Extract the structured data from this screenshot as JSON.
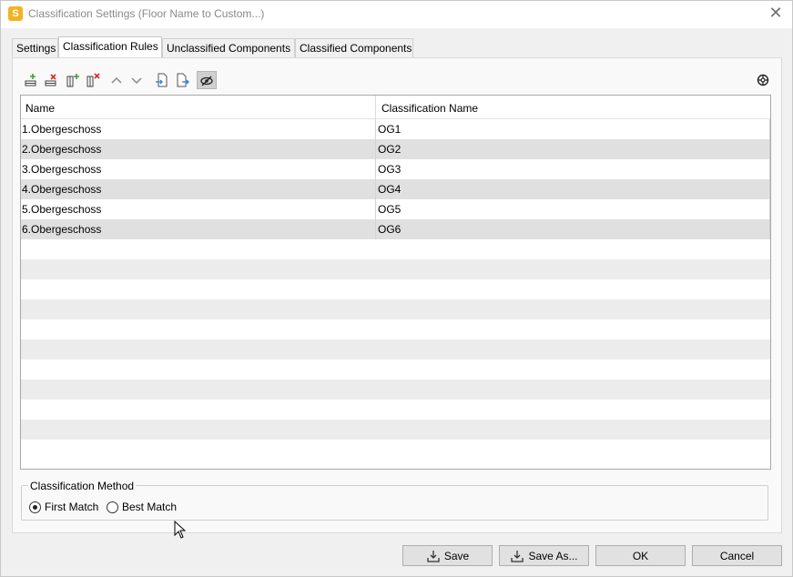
{
  "window": {
    "title": "Classification Settings (Floor Name to Custom...)",
    "app_icon_letter": "S",
    "close_glyph": "✕"
  },
  "tabs": [
    {
      "label": "Settings",
      "active": false
    },
    {
      "label": "Classification Rules",
      "active": true
    },
    {
      "label": "Unclassified Components",
      "active": false
    },
    {
      "label": "Classified Components",
      "active": false
    }
  ],
  "toolbar": {
    "icons": [
      "add-row-icon",
      "delete-row-icon",
      "add-column-icon",
      "delete-column-icon",
      "move-up-icon",
      "move-down-icon",
      "import-icon",
      "export-icon",
      "visibility-icon",
      "settings-icon"
    ],
    "pressed": "visibility-icon"
  },
  "table": {
    "columns": [
      "Name",
      "Classification Name"
    ],
    "rows": [
      {
        "name": "1.Obergeschoss",
        "classification": "OG1"
      },
      {
        "name": "2.Obergeschoss",
        "classification": "OG2"
      },
      {
        "name": "3.Obergeschoss",
        "classification": "OG3"
      },
      {
        "name": "4.Obergeschoss",
        "classification": "OG4"
      },
      {
        "name": "5.Obergeschoss",
        "classification": "OG5"
      },
      {
        "name": "6.Obergeschoss",
        "classification": "OG6"
      }
    ]
  },
  "classification_method": {
    "legend": "Classification Method",
    "options": [
      {
        "label": "First Match",
        "checked": true
      },
      {
        "label": "Best Match",
        "checked": false
      }
    ]
  },
  "buttons": {
    "save": "Save",
    "save_as": "Save As...",
    "ok": "OK",
    "cancel": "Cancel"
  },
  "colors": {
    "accent_icon": "#f3b321",
    "row_alt": "#e0e0e0",
    "add_green": "#3aa335",
    "delete_red": "#d82a2a"
  }
}
